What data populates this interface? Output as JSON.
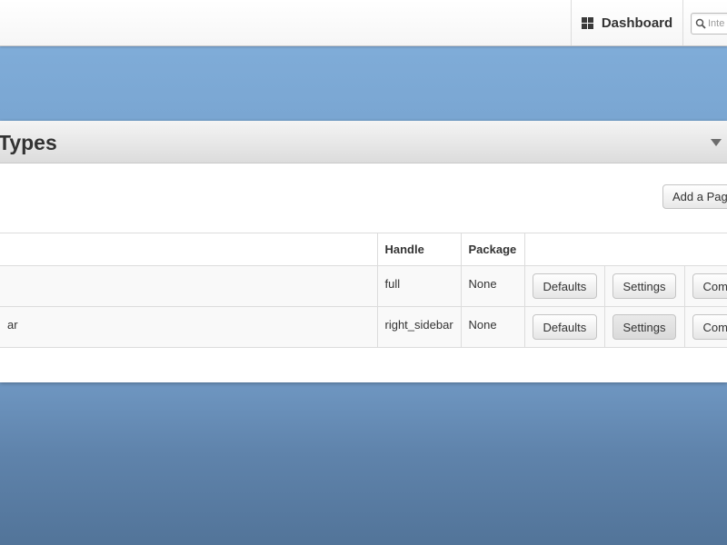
{
  "toolbar": {
    "dashboard_label": "Dashboard",
    "search_placeholder": "Inte"
  },
  "panel": {
    "title": "Types",
    "add_button_label": "Add a Pag",
    "table": {
      "headers": [
        "",
        "Handle",
        "Package",
        ""
      ],
      "rows": [
        {
          "name": "",
          "handle": "full",
          "package": "None",
          "defaults_label": "Defaults",
          "settings_label": "Settings",
          "compose_label": "Com"
        },
        {
          "name": "ar",
          "handle": "right_sidebar",
          "package": "None",
          "defaults_label": "Defaults",
          "settings_label": "Settings",
          "compose_label": "Com"
        }
      ]
    }
  },
  "colors": {
    "background_top": "#83b0dc",
    "background_bottom": "#527499",
    "panel": "#ffffff"
  }
}
